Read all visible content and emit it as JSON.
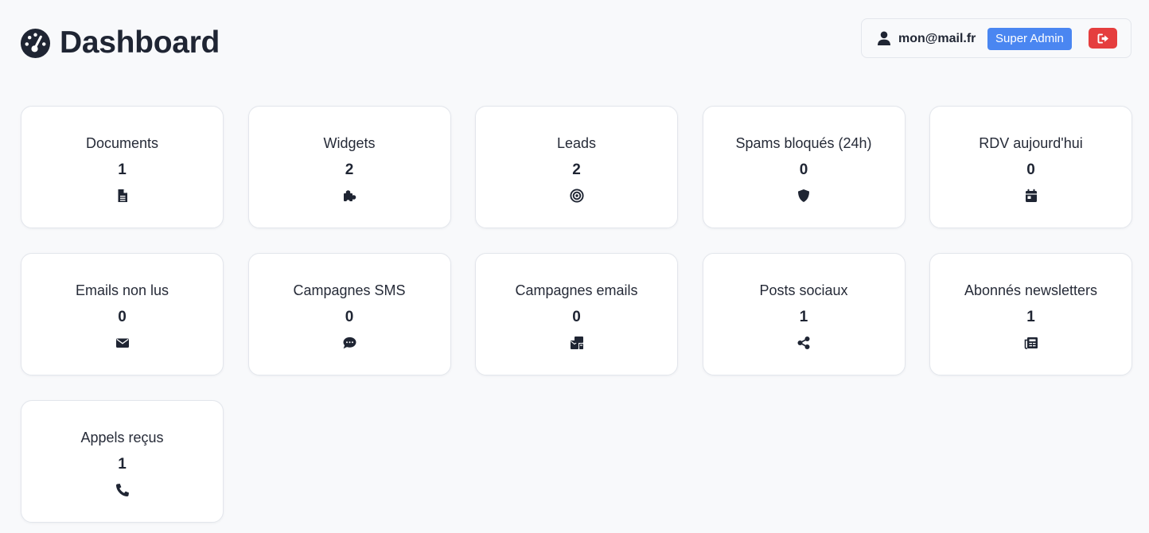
{
  "header": {
    "title": "Dashboard",
    "icon": "gauge-icon"
  },
  "user": {
    "email": "mon@mail.fr",
    "role": "Super Admin",
    "role_color": "#4a86f1",
    "logout_icon": "sign-out-icon",
    "logout_color": "#e53e3e"
  },
  "stats": [
    {
      "label": "Documents",
      "value": "1",
      "icon": "file-icon"
    },
    {
      "label": "Widgets",
      "value": "2",
      "icon": "puzzle-icon"
    },
    {
      "label": "Leads",
      "value": "2",
      "icon": "target-icon"
    },
    {
      "label": "Spams bloqués (24h)",
      "value": "0",
      "icon": "shield-icon"
    },
    {
      "label": "RDV aujourd'hui",
      "value": "0",
      "icon": "calendar-icon"
    },
    {
      "label": "Emails non lus",
      "value": "0",
      "icon": "envelope-icon"
    },
    {
      "label": "Campagnes SMS",
      "value": "0",
      "icon": "sms-icon"
    },
    {
      "label": "Campagnes emails",
      "value": "0",
      "icon": "mail-bulk-icon"
    },
    {
      "label": "Posts sociaux",
      "value": "1",
      "icon": "share-icon"
    },
    {
      "label": "Abonnés newsletters",
      "value": "1",
      "icon": "newspaper-icon"
    },
    {
      "label": "Appels reçus",
      "value": "1",
      "icon": "phone-icon"
    }
  ]
}
